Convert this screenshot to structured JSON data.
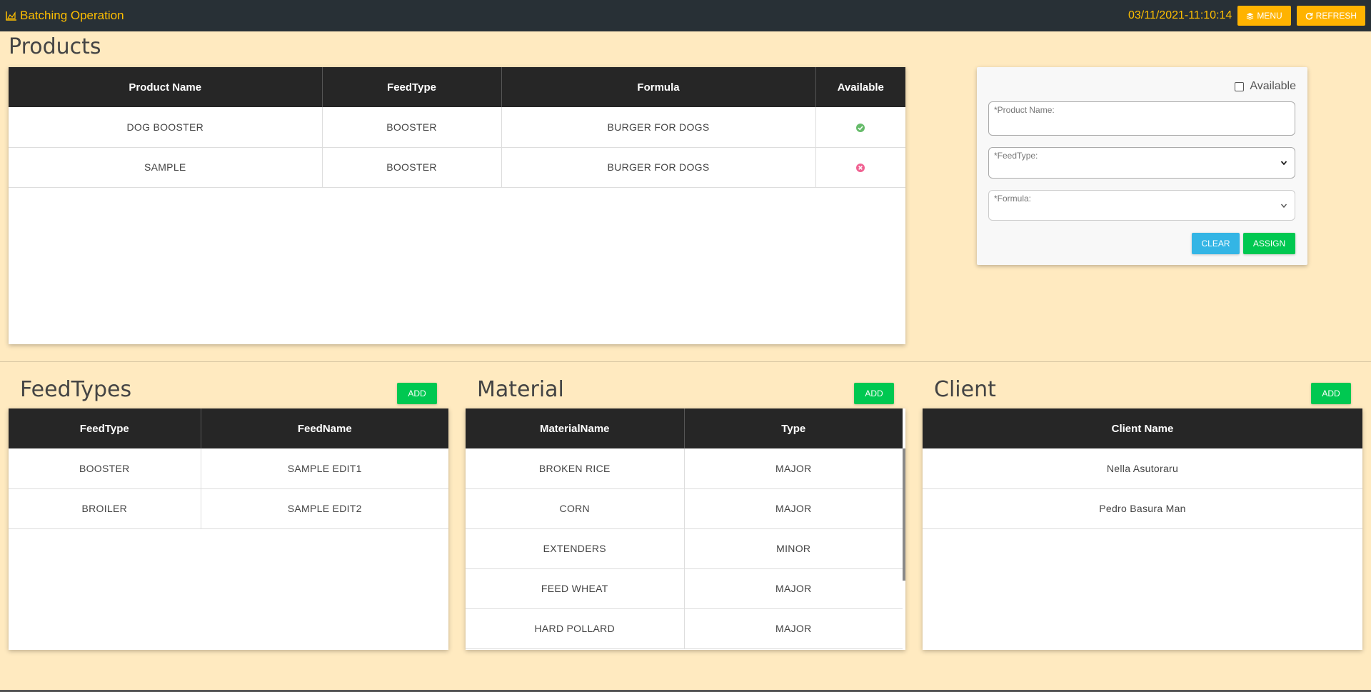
{
  "header": {
    "app_title": "Batching Operation",
    "datetime": "03/11/2021-11:10:14",
    "menu_label": "MENU",
    "refresh_label": "REFRESH"
  },
  "products": {
    "title": "Products",
    "columns": [
      "Product Name",
      "FeedType",
      "Formula",
      "Available"
    ],
    "rows": [
      {
        "name": "DOG BOOSTER",
        "feedtype": "BOOSTER",
        "formula": "BURGER FOR DOGS",
        "available": true
      },
      {
        "name": "SAMPLE",
        "feedtype": "BOOSTER",
        "formula": "BURGER FOR DOGS",
        "available": false
      }
    ]
  },
  "form": {
    "available_label": "Available",
    "product_name_label": "*Product Name:",
    "feedtype_label": "*FeedType:",
    "formula_label": "*Formula:",
    "clear_label": "CLEAR",
    "assign_label": "ASSIGN"
  },
  "feedtypes": {
    "title": "FeedTypes",
    "add_label": "ADD",
    "columns": [
      "FeedType",
      "FeedName"
    ],
    "rows": [
      [
        "BOOSTER",
        "SAMPLE EDIT1"
      ],
      [
        "BROILER",
        "SAMPLE EDIT2"
      ]
    ]
  },
  "material": {
    "title": "Material",
    "add_label": "ADD",
    "columns": [
      "MaterialName",
      "Type"
    ],
    "rows": [
      [
        "BROKEN RICE",
        "MAJOR"
      ],
      [
        "CORN",
        "MAJOR"
      ],
      [
        "EXTENDERS",
        "MINOR"
      ],
      [
        "FEED WHEAT",
        "MAJOR"
      ],
      [
        "HARD POLLARD",
        "MAJOR"
      ]
    ]
  },
  "client": {
    "title": "Client",
    "add_label": "ADD",
    "columns": [
      "Client Name"
    ],
    "rows": [
      [
        "Nella Asutoraru"
      ],
      [
        "Pedro Basura Man"
      ]
    ]
  },
  "colors": {
    "topbar": "#283036",
    "accent": "#ffbf00",
    "background": "#ffeac0",
    "available_yes": "#4caf50",
    "available_no": "#f06292"
  }
}
